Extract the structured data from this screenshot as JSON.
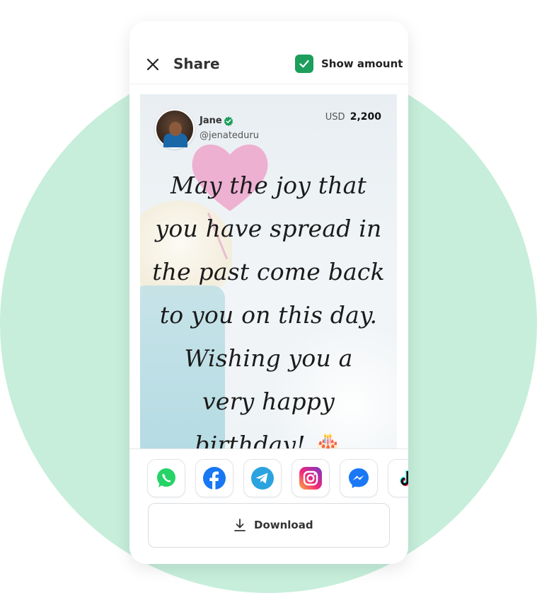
{
  "header": {
    "title": "Share",
    "show_amount_label": "Show amount",
    "show_amount_checked": true
  },
  "card": {
    "user": {
      "name": "Jane",
      "handle": "@jenateduru",
      "verified": true
    },
    "amount": {
      "currency": "USD",
      "value": "2,200"
    },
    "message_lines": [
      "May the joy that",
      "you have spread in",
      "the past come back",
      "to you on this day.",
      "Wishing you a",
      "very happy",
      "birthday!"
    ],
    "message_emoji": "🎂"
  },
  "share_targets": [
    {
      "name": "WhatsApp",
      "icon": "whatsapp-icon",
      "color": "#25d366"
    },
    {
      "name": "Facebook",
      "icon": "facebook-icon",
      "color": "#1877f2"
    },
    {
      "name": "Telegram",
      "icon": "telegram-icon",
      "color": "#2aa3de"
    },
    {
      "name": "Instagram",
      "icon": "instagram-icon",
      "color": "#e1306c"
    },
    {
      "name": "Messenger",
      "icon": "messenger-icon",
      "color": "#1a78f5"
    },
    {
      "name": "TikTok",
      "icon": "tiktok-icon",
      "color": "#000000"
    }
  ],
  "download": {
    "label": "Download"
  },
  "colors": {
    "accent": "#1c9e5c",
    "background_circle": "#c6eedb"
  }
}
